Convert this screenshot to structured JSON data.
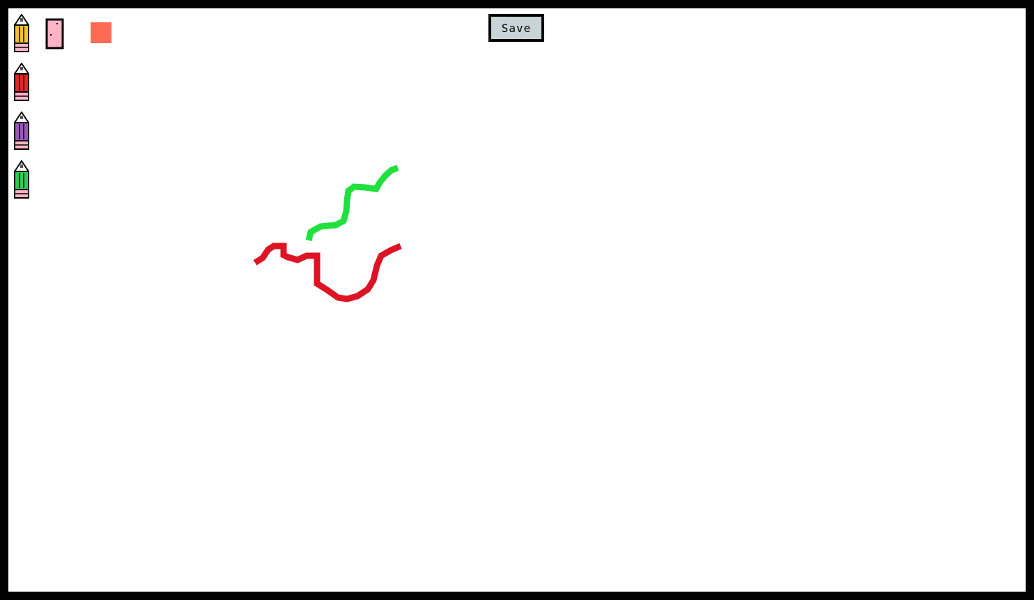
{
  "toolbar": {
    "save_label": "Save",
    "pencils": [
      {
        "name": "yellow",
        "color": "#f2c230"
      },
      {
        "name": "red",
        "color": "#e02828"
      },
      {
        "name": "purple",
        "color": "#9b59b6"
      },
      {
        "name": "green",
        "color": "#2ecc55"
      }
    ],
    "eraser": {
      "icon": "eraser-icon",
      "color": "#ffb3c6"
    },
    "selected_color": "#ff6a55"
  },
  "canvas": {
    "background": "#ffffff",
    "strokes": [
      {
        "color": "#1fe03c"
      },
      {
        "color": "#dd1424"
      }
    ]
  }
}
